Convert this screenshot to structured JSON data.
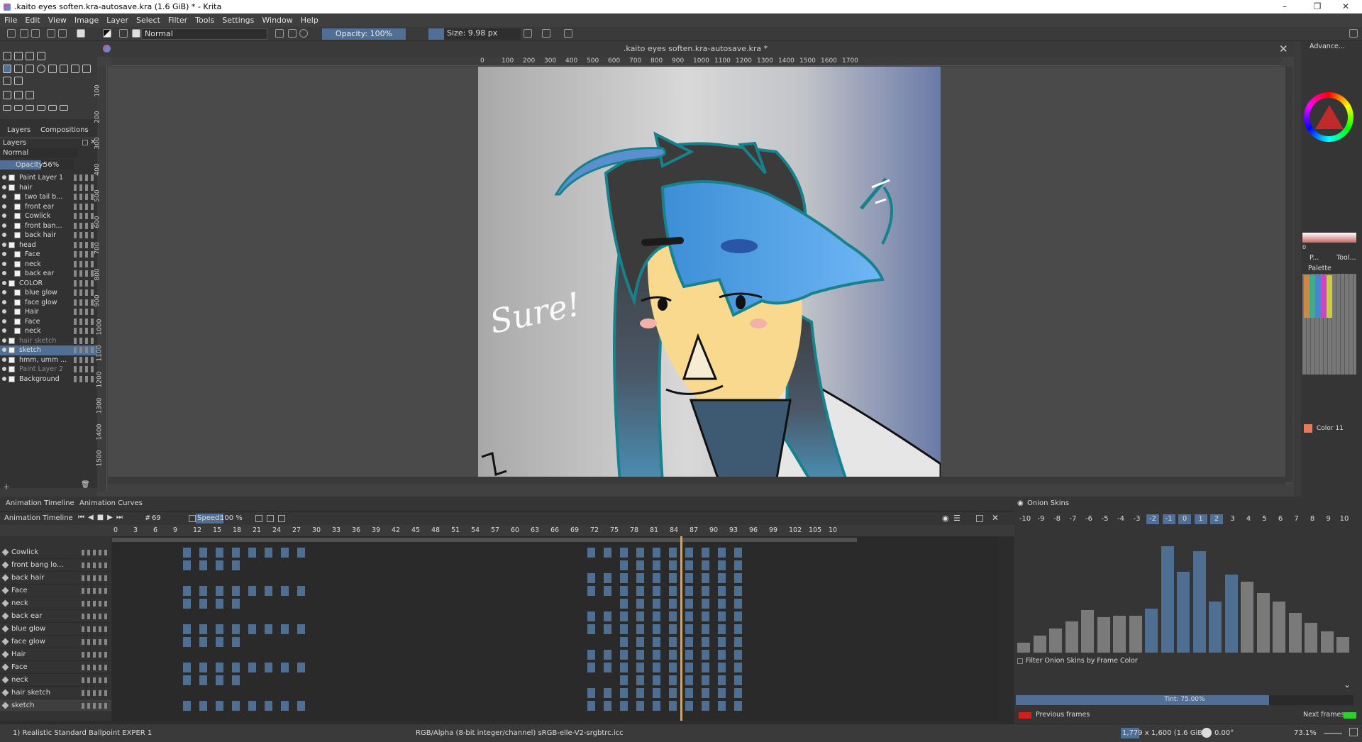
{
  "window": {
    "title": ".kaito eyes soften.kra-autosave.kra (1.6 GiB)  * - Krita",
    "minimize": "–",
    "maximize": "❐",
    "close": "✕"
  },
  "menu": [
    "File",
    "Edit",
    "View",
    "Image",
    "Layer",
    "Select",
    "Filter",
    "Tools",
    "Settings",
    "Window",
    "Help"
  ],
  "toolbar": {
    "blend_mode": "Normal",
    "opacity": "Opacity: 100%",
    "size": "Size: 9.98 px"
  },
  "document_tab": ".kaito eyes soften.kra-autosave.kra *",
  "ruler_h": [
    "0",
    "100",
    "200",
    "300",
    "400",
    "500",
    "600",
    "700",
    "800",
    "900",
    "1000",
    "1100",
    "1200",
    "1300",
    "1400",
    "1500",
    "1600",
    "1700"
  ],
  "ruler_v": [
    "100",
    "200",
    "300",
    "400",
    "500",
    "600",
    "700",
    "800",
    "900",
    "1000",
    "1100",
    "1200",
    "1300",
    "1400",
    "1500"
  ],
  "layers_panel": {
    "tabs": [
      "Layers",
      "Compositions"
    ],
    "header": "Layers",
    "blend": "Normal",
    "opacity_label": "Opacity:",
    "opacity_value": "56%",
    "items": [
      {
        "name": "Paint Layer 1",
        "indent": 0,
        "dim": false,
        "selected": false
      },
      {
        "name": "hair",
        "indent": 0,
        "dim": false,
        "selected": false
      },
      {
        "name": "two tail b...",
        "indent": 1,
        "dim": false,
        "selected": false
      },
      {
        "name": "front ear",
        "indent": 1,
        "dim": false,
        "selected": false
      },
      {
        "name": "Cowlick",
        "indent": 1,
        "dim": false,
        "selected": false
      },
      {
        "name": "front ban...",
        "indent": 1,
        "dim": false,
        "selected": false
      },
      {
        "name": "back hair",
        "indent": 1,
        "dim": false,
        "selected": false
      },
      {
        "name": "head",
        "indent": 0,
        "dim": false,
        "selected": false
      },
      {
        "name": "Face",
        "indent": 1,
        "dim": false,
        "selected": false
      },
      {
        "name": "neck",
        "indent": 1,
        "dim": false,
        "selected": false
      },
      {
        "name": "back ear",
        "indent": 1,
        "dim": false,
        "selected": false
      },
      {
        "name": "COLOR",
        "indent": 0,
        "dim": false,
        "selected": false
      },
      {
        "name": "blue glow",
        "indent": 1,
        "dim": false,
        "selected": false
      },
      {
        "name": "face glow",
        "indent": 1,
        "dim": false,
        "selected": false
      },
      {
        "name": "Hair",
        "indent": 1,
        "dim": false,
        "selected": false
      },
      {
        "name": "Face",
        "indent": 1,
        "dim": false,
        "selected": false
      },
      {
        "name": "neck",
        "indent": 1,
        "dim": false,
        "selected": false
      },
      {
        "name": "hair sketch",
        "indent": 0,
        "dim": true,
        "selected": false
      },
      {
        "name": "sketch",
        "indent": 0,
        "dim": false,
        "selected": true
      },
      {
        "name": "hmm, umm ...",
        "indent": 0,
        "dim": false,
        "selected": false
      },
      {
        "name": "Paint Layer 2",
        "indent": 0,
        "dim": true,
        "selected": false
      },
      {
        "name": "Background",
        "indent": 0,
        "dim": false,
        "selected": false
      }
    ]
  },
  "canvas_text": "Sure!",
  "right_docker": {
    "advanced_tab": "Advance...",
    "tab_p": "P...",
    "tab_tool": "Tool...",
    "palette_label": "Palette",
    "color_label": "Color 11",
    "slider_zero": "0"
  },
  "timeline": {
    "tabs": [
      "Animation Timeline",
      "Animation Curves"
    ],
    "header": "Animation Timeline",
    "frame": "69",
    "speed_label": "Speed:",
    "speed_value": "100 %",
    "frame_numbers": [
      "0",
      "3",
      "6",
      "9",
      "12",
      "15",
      "18",
      "21",
      "24",
      "27",
      "30",
      "33",
      "36",
      "39",
      "42",
      "45",
      "48",
      "51",
      "54",
      "57",
      "60",
      "63",
      "66",
      "69",
      "72",
      "75",
      "78",
      "81",
      "84",
      "87",
      "90",
      "93",
      "96",
      "99",
      "102",
      "105",
      "10"
    ],
    "tracks": [
      "Cowlick",
      "front bang lo...",
      "back hair",
      "Face",
      "neck",
      "back ear",
      "blue glow",
      "face glow",
      "Hair",
      "Face",
      "neck",
      "hair sketch",
      "sketch"
    ]
  },
  "onion": {
    "title": "Onion Skins",
    "numbers": [
      "-10",
      "-9",
      "-8",
      "-7",
      "-6",
      "-5",
      "-4",
      "-3",
      "-2",
      "-1",
      "0",
      "1",
      "2",
      "3",
      "4",
      "5",
      "6",
      "7",
      "8",
      "9",
      "10"
    ],
    "active": [
      "-2",
      "-1",
      "0",
      "1",
      "2"
    ],
    "filter_label": "Filter Onion Skins by Frame Color",
    "tint": "Tint: 75.00%",
    "tint_level": 0.75,
    "previous_frames": "Previous frames",
    "next_frames": "Next frames",
    "previous_color": "#d11f1f",
    "next_color": "#2fcf2f"
  },
  "status": {
    "brush": "1) Realistic Standard Ballpoint EXPER 1",
    "colorspace": "RGB/Alpha (8-bit integer/channel)  sRGB-elle-V2-srgbtrc.icc",
    "dimensions": "1,779 x 1,600 (1.6 GiB)",
    "rotation": "0.00°",
    "zoom": "73.1%"
  },
  "colors": {
    "accent": "#516f95",
    "keyframe": "#4e6e92",
    "playhead": "#f0a030"
  }
}
